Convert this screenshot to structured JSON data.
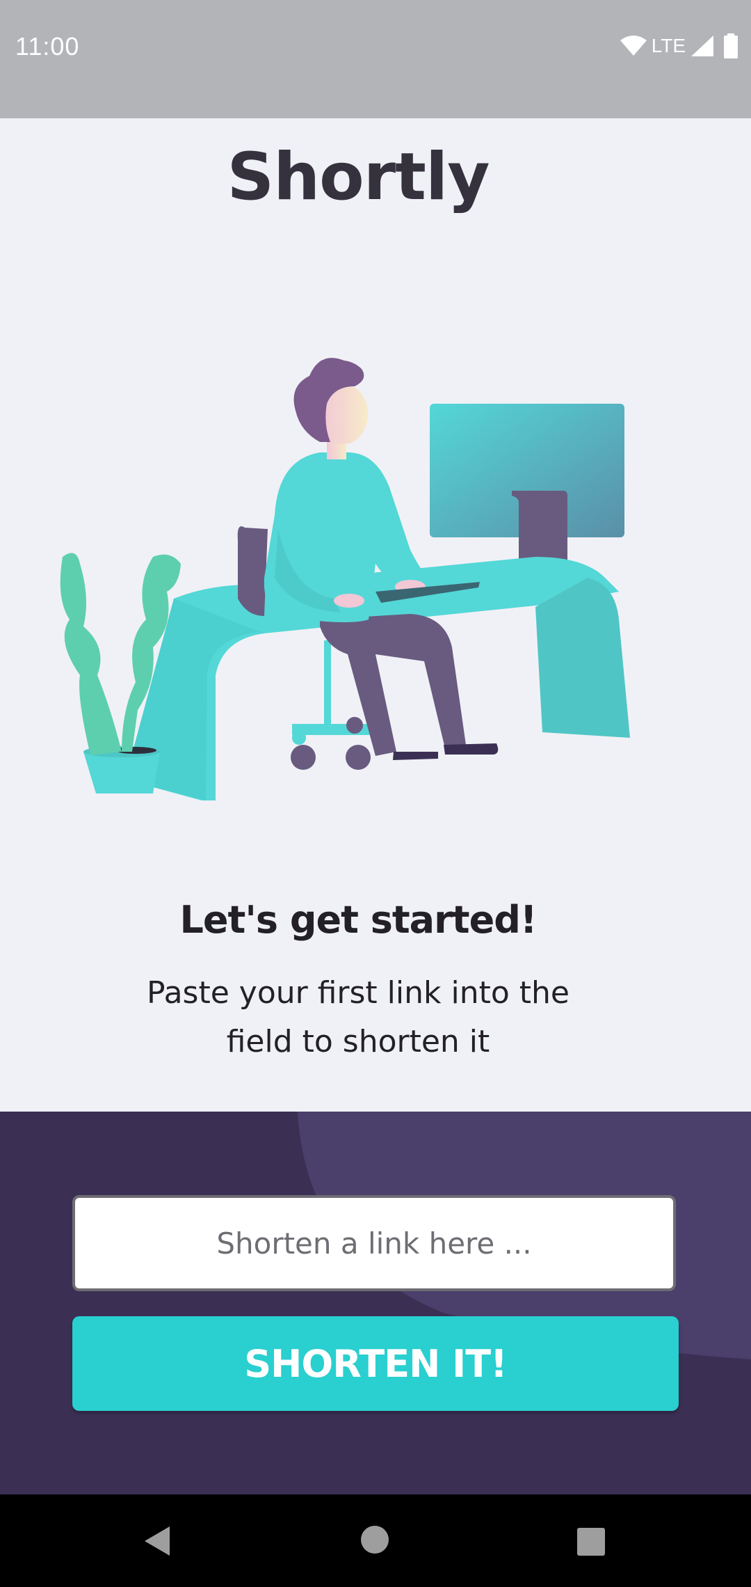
{
  "status_bar": {
    "time": "11:00",
    "network": "LTE",
    "icons": [
      "wifi-icon",
      "signal-icon",
      "battery-icon"
    ]
  },
  "app": {
    "title": "Shortly"
  },
  "onboarding": {
    "headline": "Let's get started!",
    "subtitle": "Paste your first link into the field to shorten it"
  },
  "shorten_form": {
    "placeholder": "Shorten a link here ...",
    "button_label": "SHORTEN IT!"
  },
  "nav_bar": {
    "icons": [
      "back-icon",
      "home-icon",
      "recents-icon"
    ]
  },
  "colors": {
    "primary": "#2ACFCF",
    "dark_violet": "#3B3054",
    "light_violet": "#4B3F6B",
    "background": "#F0F1F6",
    "text_dark": "#35323E"
  }
}
